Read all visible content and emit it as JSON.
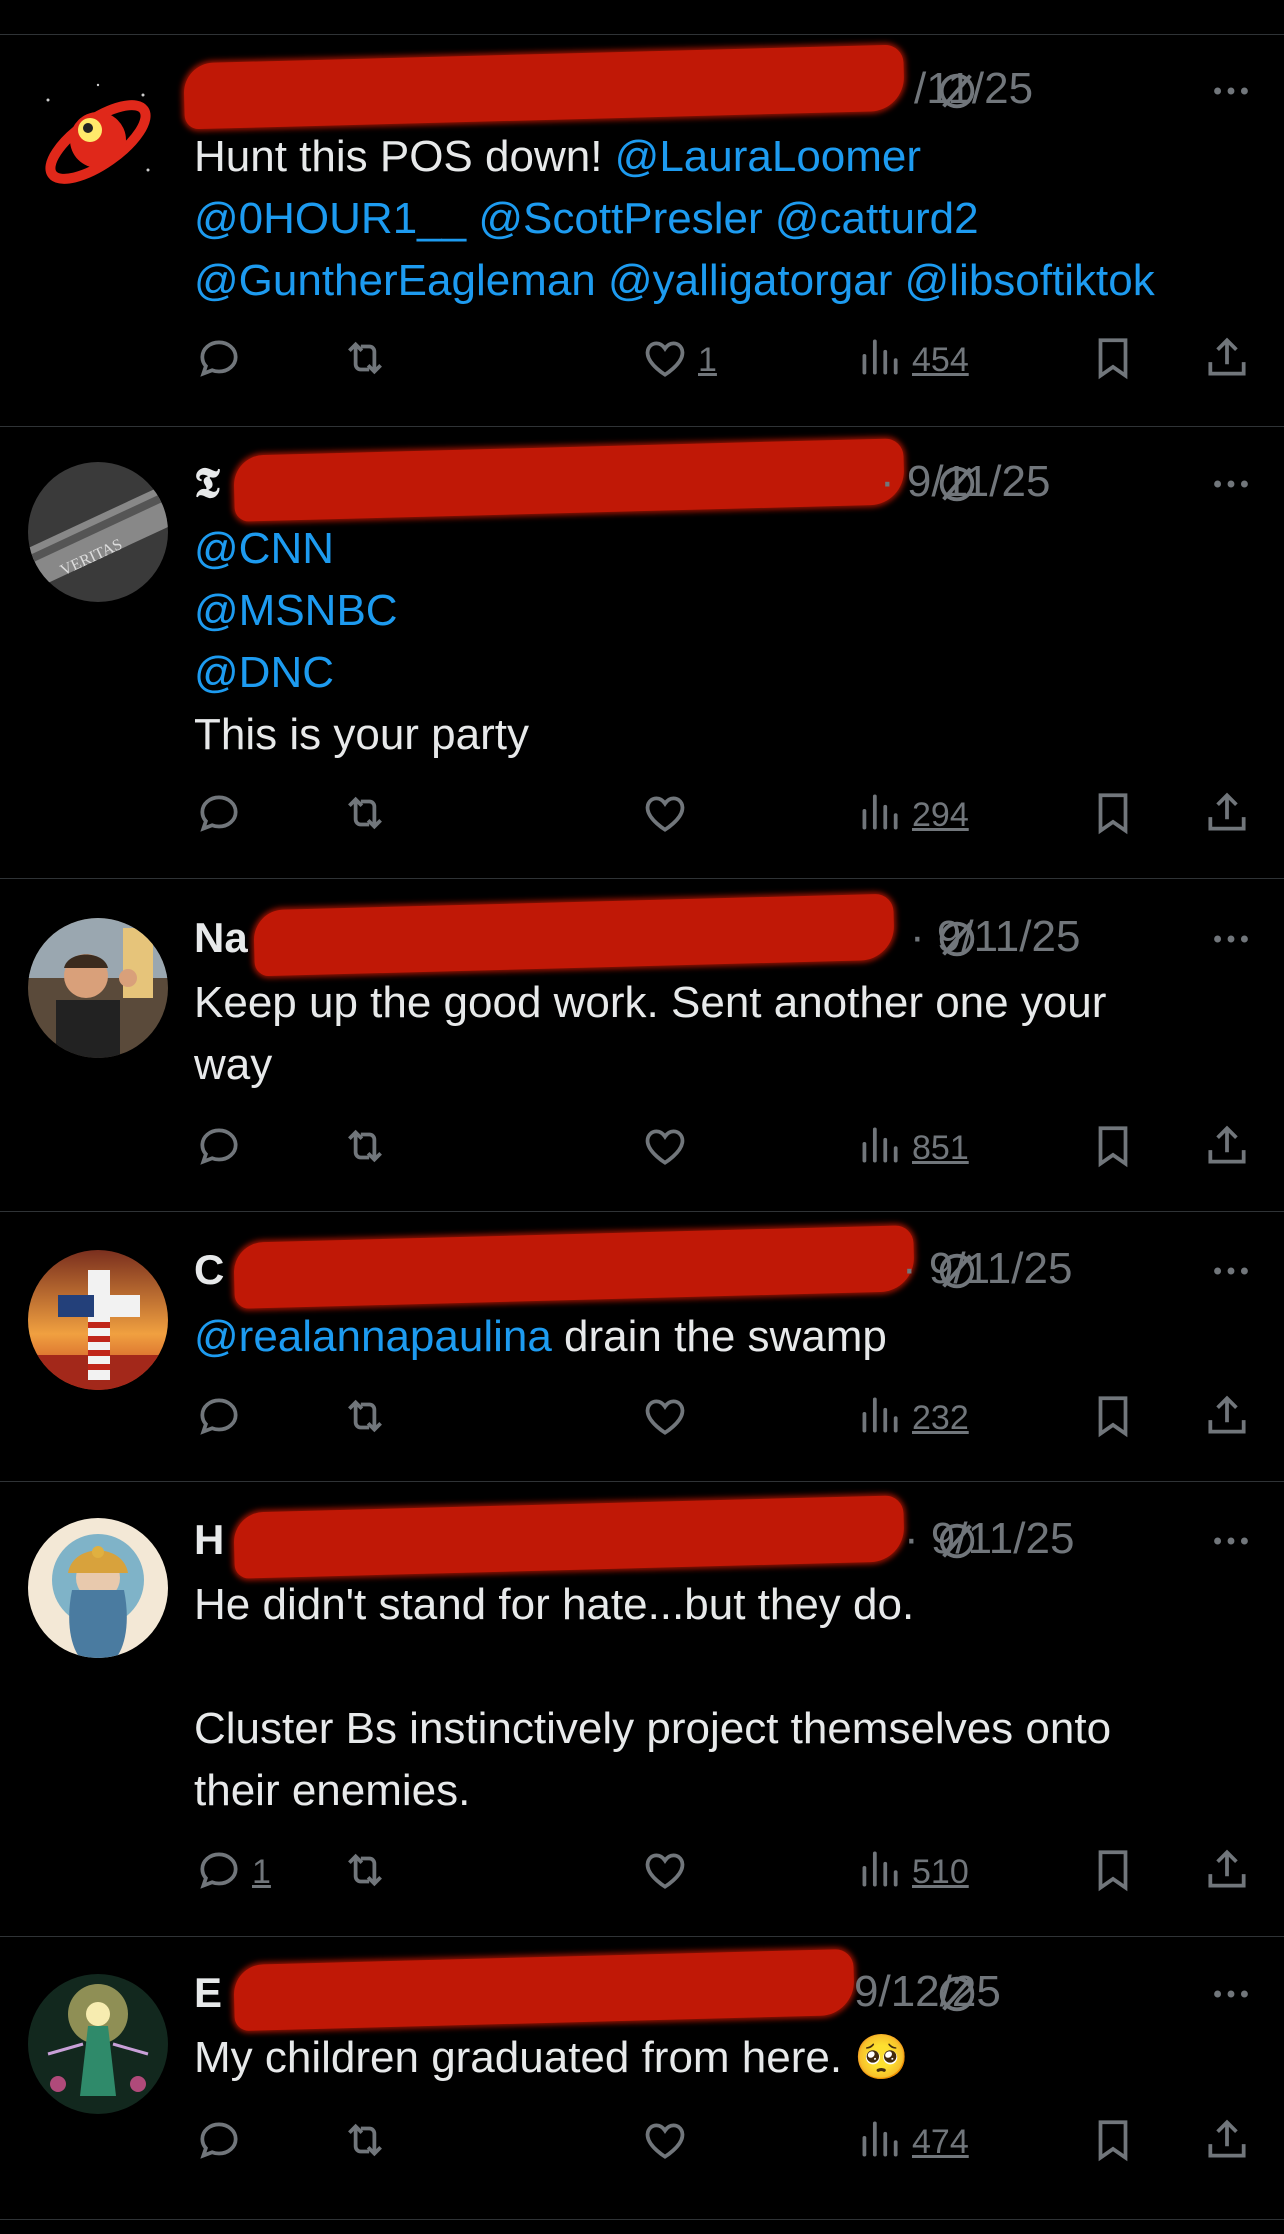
{
  "colors": {
    "background": "#000000",
    "text": "#e7e9ea",
    "muted": "#71767b",
    "mention": "#1d9bf0",
    "redaction": "#c01806",
    "divider": "#2f3336"
  },
  "tweets": [
    {
      "name_visible": "",
      "date": "/11/25",
      "body": [
        [
          {
            "t": "Hunt this POS down! ",
            "m": false
          },
          {
            "t": "@LauraLoomer",
            "m": true
          }
        ],
        [
          {
            "t": "@0HOUR1__",
            "m": true
          },
          {
            "t": " ",
            "m": false
          },
          {
            "t": "@ScottPresler",
            "m": true
          },
          {
            "t": " ",
            "m": false
          },
          {
            "t": "@catturd2",
            "m": true
          }
        ],
        [
          {
            "t": "@GuntherEagleman",
            "m": true
          },
          {
            "t": " ",
            "m": false
          },
          {
            "t": "@yalligatorgar",
            "m": true
          },
          {
            "t": " ",
            "m": false
          },
          {
            "t": "@libsoftiktok",
            "m": true
          }
        ]
      ],
      "replies": "",
      "likes": "1",
      "views": "454",
      "avatar": "rocket-planet-icon"
    },
    {
      "name_visible": "𝕿",
      "date": "· 9/11/25",
      "body": [
        [
          {
            "t": "@CNN",
            "m": true
          }
        ],
        [
          {
            "t": "@MSNBC",
            "m": true
          }
        ],
        [
          {
            "t": "@DNC",
            "m": true
          }
        ],
        [
          {
            "t": "This is your party",
            "m": false
          }
        ]
      ],
      "replies": "",
      "likes": "",
      "views": "294",
      "avatar": "gun-engraving-icon"
    },
    {
      "name_visible": "Na",
      "date": "· 9/11/25",
      "body": [
        [
          {
            "t": "Keep up the good work. Sent another one your",
            "m": false
          }
        ],
        [
          {
            "t": "way",
            "m": false
          }
        ]
      ],
      "replies": "",
      "likes": "",
      "views": "851",
      "avatar": "man-portrait"
    },
    {
      "name_visible": "C",
      "date": "· 9/11/25",
      "body": [
        [
          {
            "t": "@realannapaulina",
            "m": true
          },
          {
            "t": " drain the swamp",
            "m": false
          }
        ]
      ],
      "replies": "",
      "likes": "",
      "views": "232",
      "avatar": "flag-cross-sunset"
    },
    {
      "name_visible": "H",
      "date": "· 9/11/25",
      "body": [
        [
          {
            "t": "He didn't stand for hate...but they do.",
            "m": false
          }
        ],
        [
          {
            "t": "",
            "m": false
          }
        ],
        [
          {
            "t": "Cluster Bs instinctively project themselves onto",
            "m": false
          }
        ],
        [
          {
            "t": "their enemies.",
            "m": false
          }
        ]
      ],
      "replies": "1",
      "likes": "",
      "views": "510",
      "avatar": "goddess-painting"
    },
    {
      "name_visible": "E",
      "date": "9/12/25",
      "body": [
        [
          {
            "t": "My children graduated from here.  🥺",
            "m": false
          }
        ]
      ],
      "replies": "",
      "likes": "",
      "views": "474",
      "avatar": "glowing-figure-painting"
    }
  ]
}
